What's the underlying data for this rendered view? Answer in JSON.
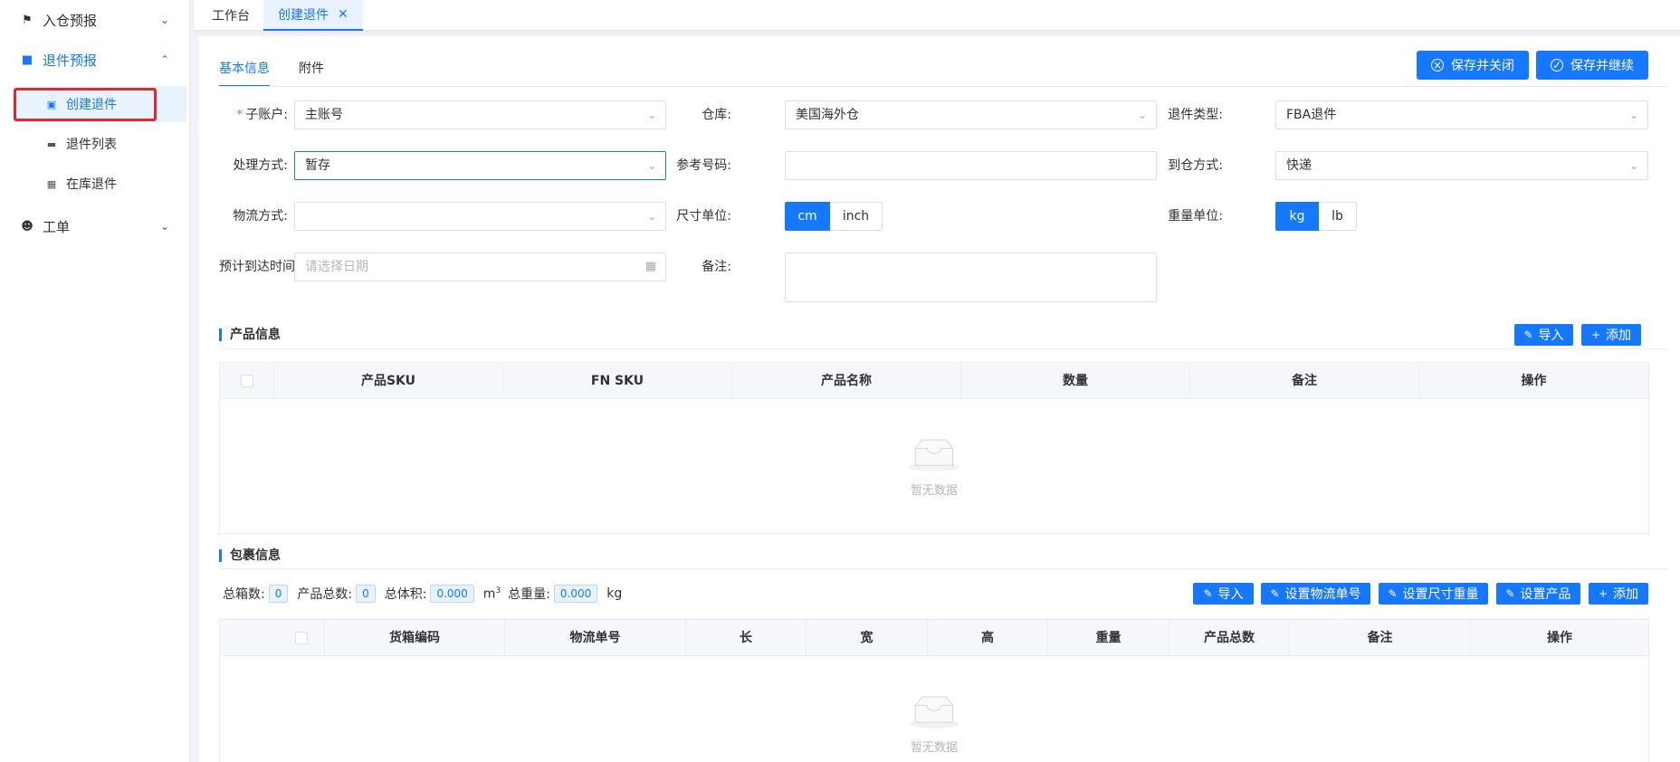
{
  "sidebar": {
    "items": [
      {
        "label": "入仓预报",
        "icon": "flag-icon"
      },
      {
        "label": "退件预报",
        "icon": "bag-icon"
      },
      {
        "label": "工单",
        "icon": "user-icon"
      }
    ],
    "sub_items": [
      {
        "label": "创建退件",
        "icon": "box-icon"
      },
      {
        "label": "退件列表",
        "icon": "card-icon"
      },
      {
        "label": "在库退件",
        "icon": "archive-icon"
      }
    ]
  },
  "page_tabs": [
    {
      "label": "工作台"
    },
    {
      "label": "创建退件"
    }
  ],
  "sub_tabs": [
    {
      "label": "基本信息"
    },
    {
      "label": "附件"
    }
  ],
  "actions": {
    "save_close": "保存并关闭",
    "save_continue": "保存并继续"
  },
  "form": {
    "sub_account": {
      "label": "子账户:",
      "value": "主账号"
    },
    "warehouse": {
      "label": "仓库:",
      "value": "美国海外仓"
    },
    "return_type": {
      "label": "退件类型:",
      "value": "FBA退件"
    },
    "handling": {
      "label": "处理方式:",
      "value": "暂存"
    },
    "reference": {
      "label": "参考号码:",
      "value": ""
    },
    "arrival_method": {
      "label": "到仓方式:",
      "value": "快递"
    },
    "logistics": {
      "label": "物流方式:",
      "value": ""
    },
    "size_unit": {
      "label": "尺寸单位:",
      "options": [
        "cm",
        "inch"
      ],
      "selected": "cm"
    },
    "weight_unit": {
      "label": "重量单位:",
      "options": [
        "kg",
        "lb"
      ],
      "selected": "kg"
    },
    "eta": {
      "label": "预计到达时间",
      "placeholder": "请选择日期"
    },
    "remark": {
      "label": "备注:"
    }
  },
  "product": {
    "title": "产品信息",
    "import": "导入",
    "add": "添加",
    "columns": [
      "产品SKU",
      "FN SKU",
      "产品名称",
      "数量",
      "备注",
      "操作"
    ],
    "empty": "暂无数据"
  },
  "package": {
    "title": "包裹信息",
    "summary": {
      "total_boxes_label": "总箱数:",
      "total_boxes": "0",
      "total_products_label": "产品总数:",
      "total_products": "0",
      "total_volume_label": "总体积:",
      "total_volume": "0.000",
      "volume_unit": "m",
      "total_weight_label": "总重量:",
      "total_weight": "0.000",
      "weight_unit": "kg"
    },
    "buttons": {
      "import": "导入",
      "set_tracking": "设置物流单号",
      "set_size_weight": "设置尺寸重量",
      "set_product": "设置产品",
      "add": "添加"
    },
    "columns": [
      "货箱编码",
      "物流单号",
      "长",
      "宽",
      "高",
      "重量",
      "产品总数",
      "备注",
      "操作"
    ],
    "empty": "暂无数据"
  }
}
